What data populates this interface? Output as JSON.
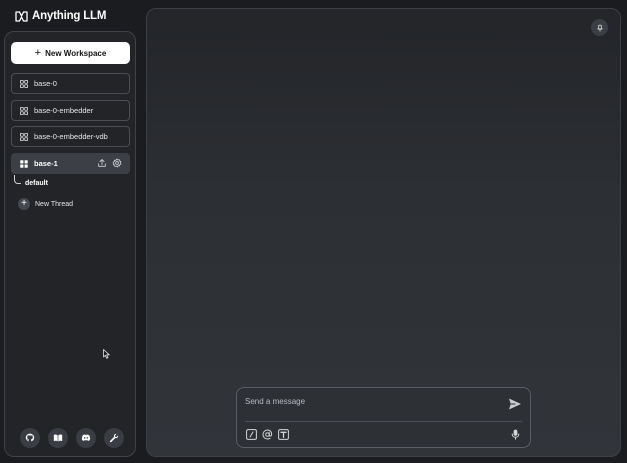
{
  "app": {
    "logo_text": "Anything LLM",
    "logo_icon": "anythingllm-logo-icon"
  },
  "sidebar": {
    "new_workspace_label": "New Workspace",
    "workspaces": [
      {
        "label": "base-0",
        "icon": "grid-icon",
        "active": false
      },
      {
        "label": "base-0-embedder",
        "icon": "grid-icon",
        "active": false
      },
      {
        "label": "base-0-embedder-vdb",
        "icon": "grid-icon",
        "active": false
      },
      {
        "label": "base-1",
        "icon": "grid-icon",
        "active": true
      }
    ],
    "active_actions": [
      "upload-icon",
      "gear-icon"
    ],
    "threads": [
      {
        "label": "default"
      }
    ],
    "new_thread_label": "New Thread",
    "footer_icons": [
      "github-icon",
      "book-icon",
      "discord-icon",
      "wrench-icon"
    ]
  },
  "main": {
    "pin_icon": "pin-icon",
    "composer": {
      "placeholder": "Send a message",
      "value": "",
      "tools": [
        "slash-command-icon",
        "at-mention-icon",
        "text-size-icon"
      ],
      "send_icon": "send-icon",
      "mic_icon": "microphone-icon"
    }
  },
  "colors": {
    "background": "#1b1c1f",
    "sidebar": "#222428",
    "active_item": "#3c3f45",
    "accent_button": "#ffffff"
  }
}
